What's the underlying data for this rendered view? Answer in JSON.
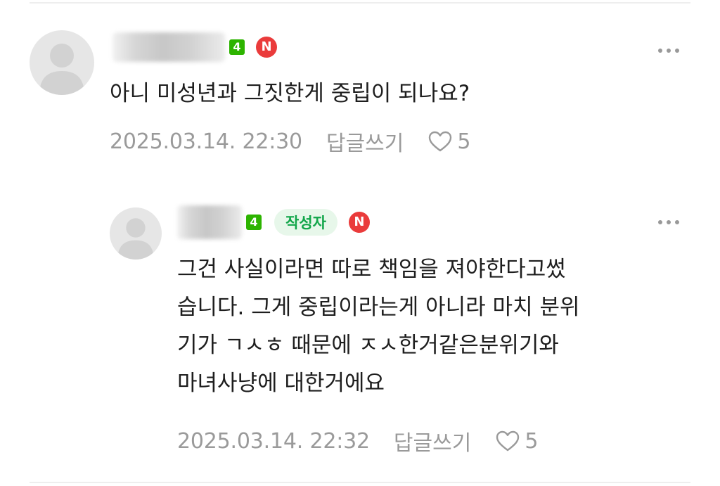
{
  "comments": [
    {
      "level": "4",
      "naver_badge": "N",
      "text": "아니 미성년과 그짓한게 중립이 되나요?",
      "date": "2025.03.14. 22:30",
      "reply_label": "답글쓰기",
      "like_count": "5"
    },
    {
      "level": "4",
      "author_badge": "작성자",
      "naver_badge": "N",
      "text_lines": [
        "그건 사실이라면 따로 책임을 져야한다고썼",
        "습니다. 그게 중립이라는게 아니라 마치 분위",
        "기가 ㄱㅅㅎ 때문에 ㅈㅅ한거같은분위기와",
        "마녀사냥에 대한거에요"
      ],
      "date": "2025.03.14. 22:32",
      "reply_label": "답글쓰기",
      "like_count": "5"
    }
  ],
  "icons": {
    "avatar": "default-profile-icon",
    "more": "more-options-icon",
    "like": "heart-outline-icon"
  },
  "colors": {
    "level_badge": "#2db400",
    "naver_badge": "#ea3b3b",
    "author_badge_bg": "#e7f7ea",
    "author_badge_text": "#12a64a",
    "meta_text": "#9a9a9a"
  }
}
